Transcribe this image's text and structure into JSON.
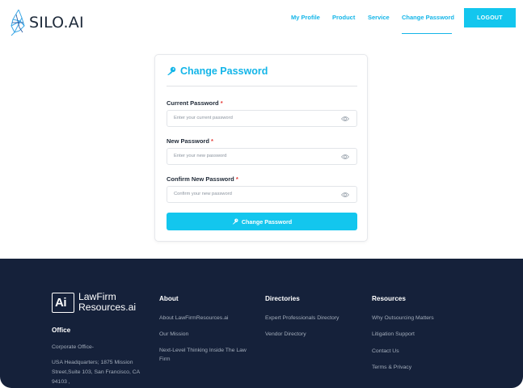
{
  "header": {
    "logo_text": "SILO.AI",
    "nav": [
      "My Profile",
      "Product",
      "Service",
      "Change Password"
    ],
    "logout_label": "LOGOUT"
  },
  "form": {
    "title": "Change Password",
    "fields": [
      {
        "label": "Current Password",
        "required_mark": "*",
        "placeholder": "Enter your current password"
      },
      {
        "label": "New Password",
        "required_mark": "*",
        "placeholder": "Enter your new password"
      },
      {
        "label": "Confirm New Password",
        "required_mark": "*",
        "placeholder": "Confirm your new password"
      }
    ],
    "submit_label": "Change Password"
  },
  "footer": {
    "brand_line1": "LawFirm",
    "brand_line2": "Resources.ai",
    "ai_mark": "Ai",
    "office": {
      "heading": "Office",
      "corporate": "Corporate Office-",
      "address_line1": "USA Headquarters; 1875 Mission",
      "address_line2": "Street,Suite 103, San Francisco, CA",
      "address_line3": "94103 ,"
    },
    "about": {
      "heading": "About",
      "links": [
        "About LawFirmResources.ai",
        "Our Mission",
        "Next-Level Thinking Inside The Law",
        "Firm"
      ]
    },
    "directories": {
      "heading": "Directories",
      "links": [
        "Expert Professionals Directory",
        "Vendor Directory"
      ]
    },
    "resources": {
      "heading": "Resources",
      "links": [
        "Why Outsourcing Matters",
        "Litigation Support",
        "Contact Us",
        "Terms & Privacy"
      ]
    }
  },
  "colors": {
    "accent": "#13C6EE",
    "footer_bg": "#15213A",
    "required": "#E53935"
  }
}
